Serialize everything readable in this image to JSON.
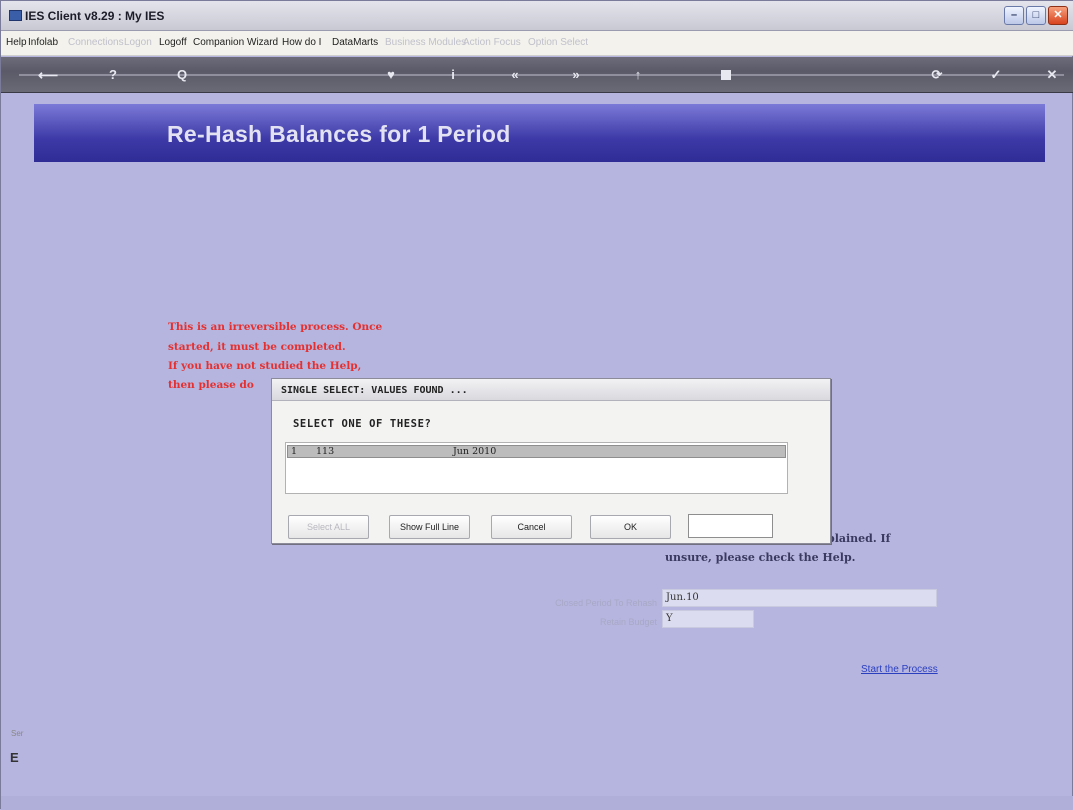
{
  "window": {
    "title": "IES Client v8.29 : My IES",
    "minimize": "–",
    "maximize": "□",
    "close": "✕"
  },
  "menu": {
    "items": [
      {
        "label": "Help",
        "enabled": true
      },
      {
        "label": "Infolab",
        "enabled": true
      },
      {
        "label": "Connections",
        "enabled": false
      },
      {
        "label": "Logon",
        "enabled": false
      },
      {
        "label": "Logoff",
        "enabled": true
      },
      {
        "label": "Companion",
        "enabled": true
      },
      {
        "label": "Wizard",
        "enabled": true
      },
      {
        "label": "How do I",
        "enabled": true
      },
      {
        "label": "DataMarts",
        "enabled": true
      },
      {
        "label": "Business Modules",
        "enabled": false
      },
      {
        "label": "Action Focus",
        "enabled": false
      },
      {
        "label": "Option Select",
        "enabled": false
      }
    ]
  },
  "toolbar": {
    "icons": [
      "back-arrow-icon",
      "help-icon",
      "search-icon",
      "heart-icon",
      "info-icon",
      "rewind-icon",
      "fast-forward-icon",
      "up-icon",
      "stop-icon",
      "refresh-icon",
      "check-icon",
      "close-icon"
    ],
    "glyphs": {
      "help": "?",
      "search": "Q",
      "heart": "♥",
      "info": "i",
      "rewind": "«",
      "forward": "»",
      "up": "↑",
      "check": "✓",
      "close": "✕",
      "refresh": "⟳"
    }
  },
  "page": {
    "title": "Re-Hash Balances for 1 Period",
    "warning_lines": [
      "This is an irreversible process. Once",
      "started, it must be completed.",
      "If you have not studied the Help,",
      "then please do"
    ],
    "note_line1": "plained. If",
    "note_line2": "unsure, please check the Help.",
    "fields": {
      "period_label": "Closed Period To Rehash",
      "period_value": "Jun.10",
      "budget_label": "Retain Budget",
      "budget_value": "Y"
    },
    "start_link": "Start the Process"
  },
  "dialog": {
    "title": "SINGLE SELECT: VALUES FOUND ...",
    "prompt": "SELECT ONE OF THESE?",
    "rows": [
      {
        "index": "1",
        "code": "113",
        "period": "Jun 2010"
      }
    ],
    "buttons": {
      "select_all": "Select ALL",
      "show_full_line": "Show Full Line",
      "cancel": "Cancel",
      "ok": "OK"
    }
  },
  "side": {
    "marks": "Ser",
    "letter": "E"
  },
  "colors": {
    "background": "#b7b6de",
    "banner": "#3d3aa7",
    "warning": "#e5302f",
    "link": "#2a3fc0"
  }
}
